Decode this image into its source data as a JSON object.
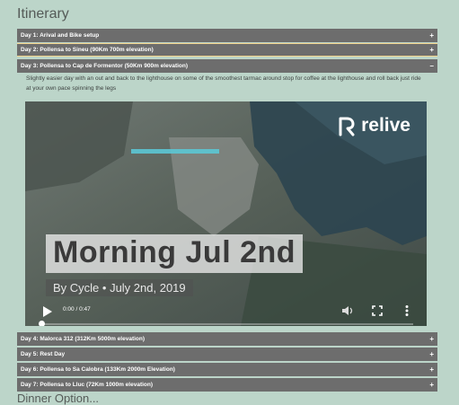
{
  "page": {
    "title": "Itinerary"
  },
  "itinerary": {
    "days": [
      {
        "label": "Day 1: Arival and Bike setup",
        "sign": "+"
      },
      {
        "label": "Day 2: Pollensa to Sineu (90Km 700m elevation)",
        "sign": "+"
      },
      {
        "label": "Day 3: Pollensa to Cap de Formentor (50Km 900m elevation)",
        "sign": "–"
      },
      {
        "label": "Day 4: Malorca 312 (312Km 5000m elevation)",
        "sign": "+"
      },
      {
        "label": "Day 5: Rest Day",
        "sign": "+"
      },
      {
        "label": "Day 6: Pollensa to Sa Calobra (133Km 2000m Elevation)",
        "sign": "+"
      },
      {
        "label": "Day 7: Pollensa to Lluc (72Km 1000m elevation)",
        "sign": "+"
      }
    ],
    "day3_description": "Slightly easier day with an out and back to the lighthouse on some of the smoothest tarmac around stop for coffee at the lighthouse and roll back just ride at your own pace spinning the legs"
  },
  "video": {
    "brand": "relive",
    "title": "Morning Jul 2nd",
    "subtitle": "By Cycle • July 2nd, 2019",
    "time": "0:00 / 0:47",
    "progress": 0.0
  },
  "next_section": {
    "partial_title": "Dinner Option..."
  },
  "icons": {
    "play": "play-icon",
    "volume": "volume-icon",
    "fullscreen": "fullscreen-icon",
    "more": "more-vertical-icon",
    "logo": "relive-logo-icon"
  }
}
